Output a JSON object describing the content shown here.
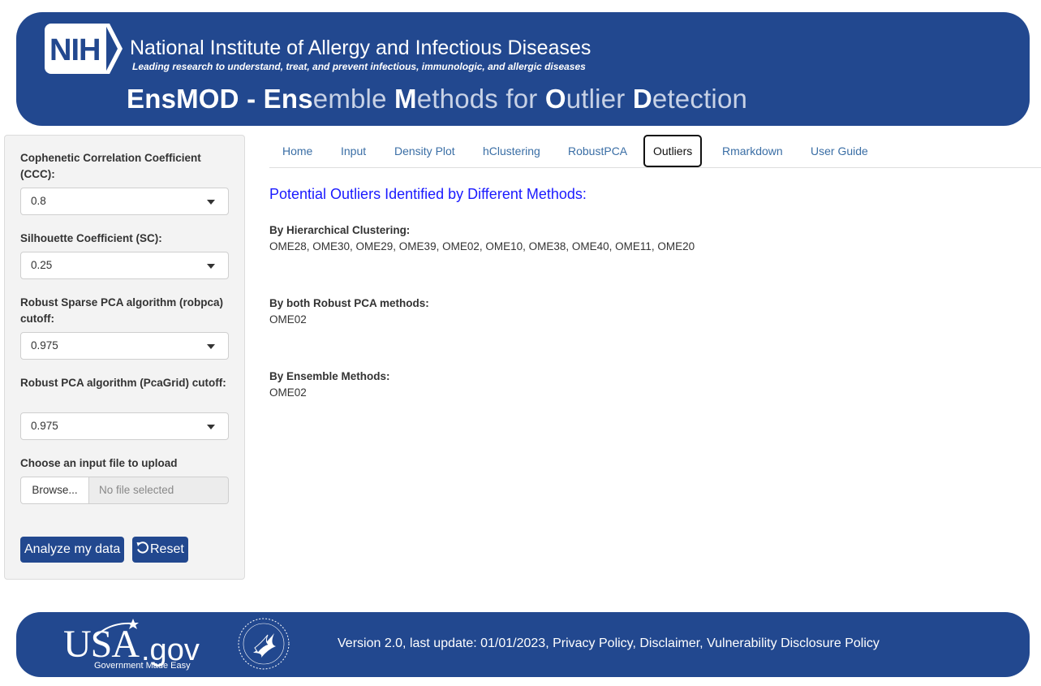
{
  "header": {
    "logo_text": "NIH",
    "institute_name": "National Institute of Allergy and Infectious Diseases",
    "tagline": "Leading research to understand, treat, and prevent infectious, immunologic, and allergic diseases",
    "app_title_parts": [
      "EnsMOD - Ens",
      "emble ",
      "M",
      "ethods for ",
      "O",
      "utlier ",
      "D",
      "etection"
    ]
  },
  "sidebar": {
    "ccc_label": "Cophenetic Correlation Coefficient (CCC):",
    "ccc_value": "0.8",
    "sc_label": "Silhouette Coefficient (SC):",
    "sc_value": "0.25",
    "robpca_label": "Robust Sparse PCA algorithm (robpca) cutoff:",
    "robpca_value": "0.975",
    "pcagrid_label": "Robust PCA algorithm (PcaGrid) cutoff:",
    "pcagrid_value": "0.975",
    "file_label": "Choose an input file to upload",
    "browse_label": "Browse...",
    "file_placeholder": "No file selected",
    "analyze_label": "Analyze my data",
    "reset_label": "Reset"
  },
  "tabs": [
    {
      "label": "Home"
    },
    {
      "label": "Input"
    },
    {
      "label": "Density Plot"
    },
    {
      "label": "hClustering"
    },
    {
      "label": "RobustPCA"
    },
    {
      "label": "Outliers"
    },
    {
      "label": "Rmarkdown"
    },
    {
      "label": "User Guide"
    }
  ],
  "active_tab": "Outliers",
  "content": {
    "title": "Potential Outliers Identified by Different Methods:",
    "sections": [
      {
        "label": "By Hierarchical Clustering:",
        "value": "OME28, OME30, OME29, OME39, OME02, OME10, OME38, OME40, OME11, OME20"
      },
      {
        "label": "By both Robust PCA methods:",
        "value": "OME02"
      },
      {
        "label": "By Ensemble Methods:",
        "value": "OME02"
      }
    ]
  },
  "footer": {
    "usa_logo_text": "USA",
    "usa_logo_domain": ".gov",
    "usa_logo_sub": "Government Made Easy",
    "version_text": "Version 2.0, last update: 01/01/2023, ",
    "links": [
      "Privacy Policy",
      "Disclaimer",
      "Vulnerability Disclosure Policy"
    ]
  },
  "colors": {
    "brand_blue": "#22488f",
    "link_blue": "#3a6ea5",
    "title_blue": "#1a1aff",
    "sidebar_bg": "#f3f3f3"
  }
}
